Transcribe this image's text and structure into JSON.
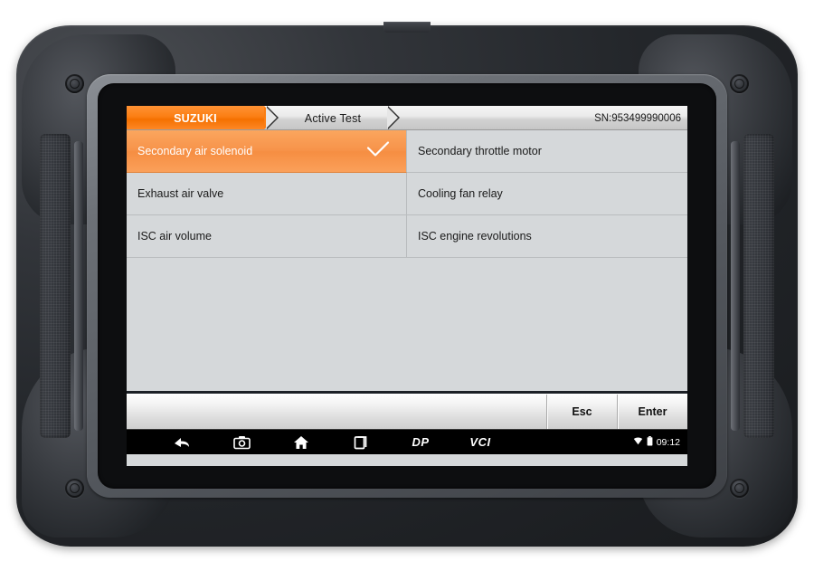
{
  "device": {
    "name": "automotive-diagnostic-tablet"
  },
  "screen": {
    "header": {
      "brand_tab": "SUZUKI",
      "function_tab": "Active Test",
      "serial": "SN:953499990006"
    },
    "list": {
      "rows": [
        {
          "left": "Secondary air solenoid",
          "right": "Secondary throttle motor",
          "selected_left": true
        },
        {
          "left": "Exhaust air valve",
          "right": "Cooling fan relay",
          "selected_left": false
        },
        {
          "left": "ISC air volume",
          "right": "ISC engine revolutions",
          "selected_left": false
        }
      ],
      "selected_item": "Secondary air solenoid",
      "check_icon": "check-icon"
    },
    "buttons": {
      "esc": "Esc",
      "enter": "Enter"
    },
    "navbar": {
      "icons": [
        "back-icon",
        "camera-icon",
        "home-icon",
        "recents-icon"
      ],
      "dp_label": "DP",
      "vci_label": "VCI",
      "wifi_icon": "wifi-icon",
      "battery_icon": "battery-icon",
      "time": "09:12"
    }
  },
  "colors": {
    "accent_orange": "#f7934a",
    "brand_tab_orange": "#fb7e12",
    "screen_grey": "#d5d8da",
    "navbar_black": "#000000"
  }
}
